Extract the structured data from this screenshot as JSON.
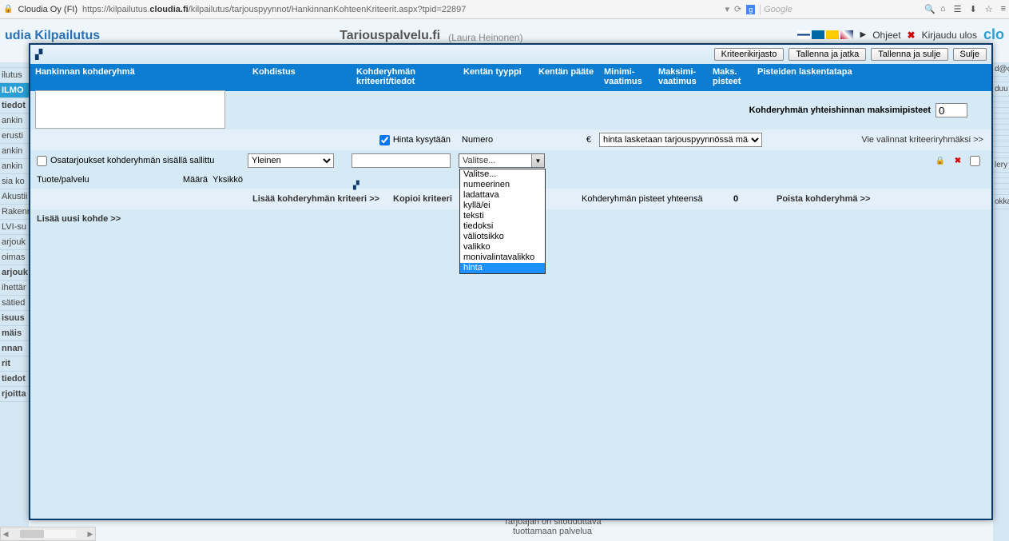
{
  "browser": {
    "site_name": "Cloudia Oy (FI)",
    "url_prefix": "https://kilpailutus.",
    "url_host": "cloudia.fi",
    "url_path": "/kilpailutus/tarjouspyynnot/HankinnanKohteenKriteerit.aspx?tpid=22897",
    "search_placeholder": "Google"
  },
  "bg": {
    "logo": "udia Kilpailutus",
    "tarjous": "Tariouspalvelu.fi",
    "user": "(Laura Heinonen)",
    "ohjeet": "Ohjeet",
    "logout": "Kirjaudu ulos",
    "cloudia": "clo",
    "left_rows": [
      "",
      "ilutus",
      "ILMO",
      "tiedot",
      "ankin",
      "erusti",
      "ankin",
      "ankin",
      "sia ko",
      "Akustii",
      "Rakenn",
      "LVI-su",
      "arjouk",
      "oimas",
      "arjouk",
      "ihettär",
      "sätied",
      "isuus",
      "mäis",
      "nnan",
      "rit",
      "tiedot",
      "rjoitta"
    ],
    "right_rows": [
      "d@c",
      "",
      "duu",
      "",
      "",
      "",
      "",
      "",
      "",
      "",
      "",
      "",
      "",
      "",
      "lery",
      "",
      "",
      "",
      "",
      "okka"
    ],
    "bottom1": "Tarjoajan on sitouduttava",
    "bottom2": "tuottamaan palvelua"
  },
  "modal": {
    "buttons": {
      "kriteerikirjasto": "Kriteerikirjasto",
      "tallenna_jatka": "Tallenna ja jatka",
      "tallenna_sulje": "Tallenna ja sulje",
      "sulje": "Sulje"
    },
    "headers": {
      "c1": "Hankinnan kohderyhmä",
      "c2": "Kohdistus",
      "c3": "Kohderyhmän kriteerit/tiedot",
      "c4": "Kentän tyyppi",
      "c5": "Kentän pääte",
      "c6": "Minimi-vaatimus",
      "c7": "Maksimi-vaatimus",
      "c8": "Maks. pisteet",
      "c9": "Pisteiden laskentatapa"
    },
    "row1": {
      "label": "Kohderyhmän yhteishinnan maksimipisteet",
      "value": "0"
    },
    "row2": {
      "hinta_kysytaan": "Hinta kysytään",
      "numero": "Numero",
      "euro": "€",
      "select_val": "hinta lasketaan tarjouspyynnössä määritell",
      "vie": "Vie valinnat kriteeriryhmäksi >>"
    },
    "row3": {
      "osa": "Osatarjoukset kohderyhmän sisällä sallittu",
      "yleinen": "Yleinen",
      "combo": "Valitse...",
      "options": [
        "Valitse...",
        "numeerinen",
        "ladattava",
        "kyllä/ei",
        "teksti",
        "tiedoksi",
        "väliotsikko",
        "valikko",
        "monivalintavalikko",
        "hinta"
      ],
      "selected_idx": 9
    },
    "row4": {
      "tuote": "Tuote/palvelu",
      "maara": "Määrä",
      "yksikko": "Yksikkö"
    },
    "row5": {
      "lisaa_kriteeri": "Lisää kohderyhmän kriteeri >>",
      "kopioi": "Kopioi kriteeri",
      "pisteet_label": "Kohderyhmän pisteet yhteensä",
      "pisteet_val": "0",
      "poista": "Poista kohderyhmä >>"
    },
    "row6": {
      "lisaa_kohde": "Lisää uusi kohde >>"
    }
  }
}
